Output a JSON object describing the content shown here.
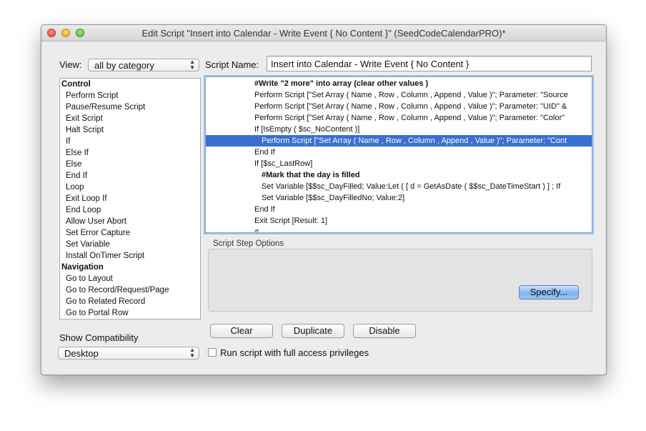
{
  "window": {
    "title": "Edit Script \"Insert into Calendar - Write Event { No Content }\" (SeedCodeCalendarPRO)*"
  },
  "view": {
    "label": "View:",
    "selected": "all by category"
  },
  "script_name": {
    "label": "Script Name:",
    "value": "Insert into Calendar - Write Event { No Content }"
  },
  "steps_list": [
    {
      "label": "Control",
      "category": true
    },
    {
      "label": "Perform Script"
    },
    {
      "label": "Pause/Resume Script"
    },
    {
      "label": "Exit Script"
    },
    {
      "label": "Halt Script"
    },
    {
      "label": "If"
    },
    {
      "label": "Else If"
    },
    {
      "label": "Else"
    },
    {
      "label": "End If"
    },
    {
      "label": "Loop"
    },
    {
      "label": "Exit Loop If"
    },
    {
      "label": "End Loop"
    },
    {
      "label": "Allow User Abort"
    },
    {
      "label": "Set Error Capture"
    },
    {
      "label": "Set Variable"
    },
    {
      "label": "Install OnTimer Script"
    },
    {
      "label": "Navigation",
      "category": true
    },
    {
      "label": "Go to Layout"
    },
    {
      "label": "Go to Record/Request/Page"
    },
    {
      "label": "Go to Related Record"
    },
    {
      "label": "Go to Portal Row"
    }
  ],
  "script_lines": [
    {
      "text": "#Write \"2 more\" into array (clear other values )",
      "indent": 0,
      "comment": true
    },
    {
      "text": "Perform Script [\"Set Array ( Name , Row , Column , Append , Value )\"; Parameter: \"Source",
      "indent": 0
    },
    {
      "text": "Perform Script [\"Set Array ( Name , Row , Column , Append , Value )\"; Parameter: \"UID\" &",
      "indent": 0
    },
    {
      "text": "Perform Script [\"Set Array ( Name , Row , Column , Append , Value )\"; Parameter: \"Color\"",
      "indent": 0
    },
    {
      "text": "If [IsEmpty ( $sc_NoContent )]",
      "indent": 0
    },
    {
      "text": "Perform Script [\"Set Array ( Name , Row , Column , Append , Value )\"; Parameter: \"Cont",
      "indent": 1,
      "selected": true
    },
    {
      "text": "End If",
      "indent": 0
    },
    {
      "text": "If [$sc_LastRow]",
      "indent": 0
    },
    {
      "text": "#Mark that the day is filled",
      "indent": 1,
      "comment": true
    },
    {
      "text": "Set Variable [$$sc_DayFilled; Value:Let ( [  d = GetAsDate ( $$sc_DateTimeStart  ) ] ;  If",
      "indent": 1
    },
    {
      "text": "Set Variable [$$sc_DayFilledNo; Value:2]",
      "indent": 1
    },
    {
      "text": "End If",
      "indent": 0
    },
    {
      "text": "Exit Script [Result: 1]",
      "indent": 0
    },
    {
      "text": "#",
      "indent": 0
    }
  ],
  "options": {
    "label": "Script Step Options",
    "specify_label": "Specify..."
  },
  "buttons": {
    "clear": "Clear",
    "duplicate": "Duplicate",
    "disable": "Disable"
  },
  "compatibility": {
    "label": "Show Compatibility",
    "selected": "Desktop"
  },
  "full_access": {
    "label": "Run script with full access privileges",
    "checked": false
  },
  "colors": {
    "selection": "#3b6fd0",
    "focus_ring": "#9cc0e8"
  }
}
